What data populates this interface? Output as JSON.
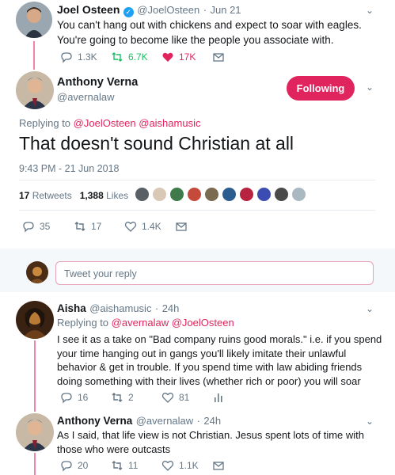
{
  "tweet1": {
    "name": "Joel Osteen",
    "handle": "@JoelOsteen",
    "date": "Jun 21",
    "text": "You can't hang out with chickens and expect to soar with eagles. You're going to become like the people you associate with.",
    "replies": "1.3K",
    "retweets": "6.7K",
    "likes": "17K"
  },
  "main": {
    "name": "Anthony Verna",
    "handle": "@avernalaw",
    "follow_label": "Following",
    "replying_prefix": "Replying to",
    "replying_to": "@JoelOsteen @aishamusic",
    "text": "That doesn't sound Christian at all",
    "timestamp": "9:43 PM - 21 Jun 2018",
    "retweets_count": "17",
    "retweets_label": "Retweets",
    "likes_count": "1,388",
    "likes_label": "Likes",
    "replies": "35",
    "retweets": "17",
    "likes": "1.4K"
  },
  "reply_box": {
    "placeholder": "Tweet your reply"
  },
  "reply1": {
    "name": "Aisha",
    "handle": "@aishamusic",
    "date": "24h",
    "replying_prefix": "Replying to",
    "replying_to": "@avernalaw @JoelOsteen",
    "text": "I see it as a take on \"Bad company ruins good morals.\" i.e. if you spend your time hanging out in gangs you'll likely imitate their unlawful behavior & get in trouble. If you spend time with law abiding friends doing something with their lives (whether rich or poor) you will soar",
    "replies": "16",
    "retweets": "2",
    "likes": "81"
  },
  "reply2": {
    "name": "Anthony Verna",
    "handle": "@avernalaw",
    "date": "24h",
    "text": "As I said, that life view is not Christian. Jesus spent lots of time with those who were outcasts",
    "replies": "20",
    "retweets": "11",
    "likes": "1.1K"
  },
  "colors": {
    "accent": "#e0245e",
    "retweet_green": "#17bf63",
    "secondary_text": "#657786",
    "verified_blue": "#1da1f2"
  },
  "icons": [
    "reply-icon",
    "retweet-icon",
    "like-icon",
    "message-icon",
    "analytics-icon",
    "verified-icon",
    "chevron-down-icon"
  ]
}
